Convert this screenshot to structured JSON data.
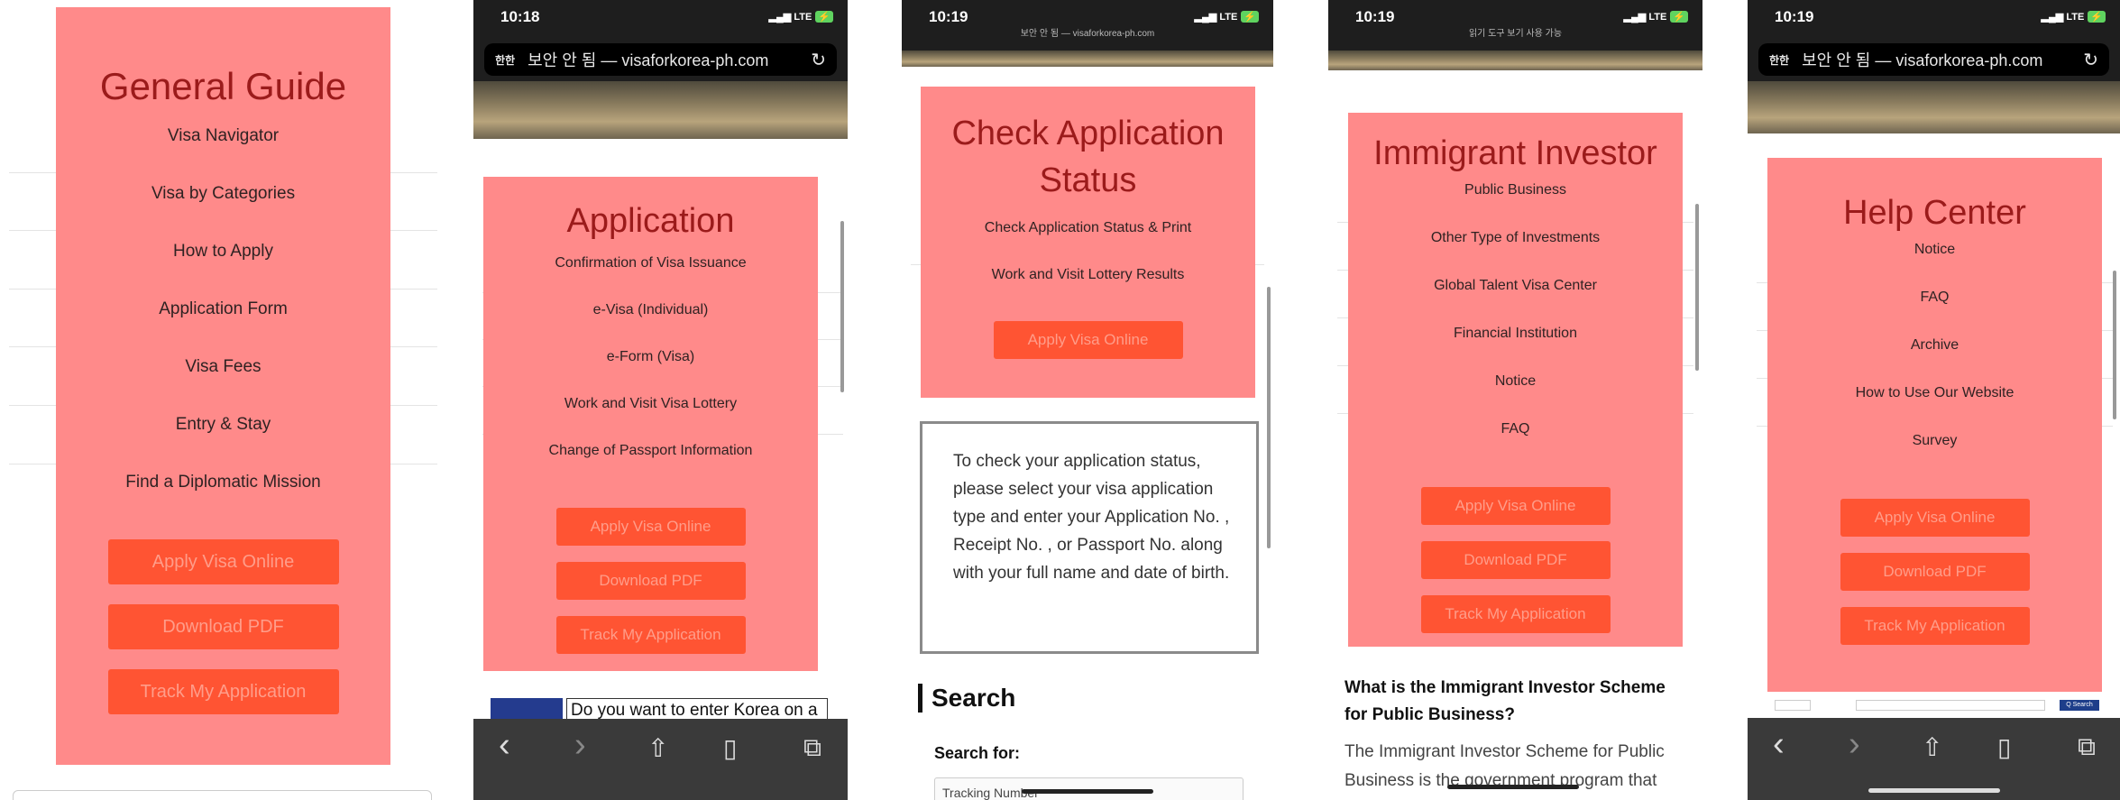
{
  "p1": {
    "title": "General Guide",
    "items": [
      "Visa Navigator",
      "Visa by Categories",
      "How to Apply",
      "Application Form",
      "Visa Fees",
      "Entry & Stay",
      "Find a Diplomatic Mission"
    ],
    "buttons": [
      "Apply Visa Online",
      "Download PDF",
      "Track My Application"
    ]
  },
  "p2": {
    "time": "10:18",
    "signal": "LTE",
    "lang": "한한",
    "url": "보안 안 됨 — visaforkorea-ph.com",
    "title": "Application",
    "items": [
      "Confirmation of Visa Issuance",
      "e-Visa (Individual)",
      "e-Form (Visa)",
      "Work and Visit Visa Lottery",
      "Change of Passport Information"
    ],
    "buttons": [
      "Apply Visa Online",
      "Download PDF",
      "Track My Application"
    ],
    "banner": "Do you want to enter Korea on a"
  },
  "p3": {
    "time": "10:19",
    "signal": "LTE",
    "mini_url": "보안 안 됨 — visaforkorea-ph.com",
    "title": "Check Application Status",
    "items": [
      "Check Application Status & Print",
      "Work and Visit Lottery Results"
    ],
    "buttons": [
      "Apply Visa Online"
    ],
    "info": "To check your application status, please select your visa application type and enter your Application No. , Receipt No. , or Passport No. along with your full name and date of birth.",
    "search_heading": "Search",
    "search_for_label": "Search for:",
    "search_for_value": "Tracking Number"
  },
  "p4": {
    "time": "10:19",
    "signal": "LTE",
    "mini_url": "읽기 도구 보기 사용 가능",
    "title": "Immigrant Investor",
    "items": [
      "Public Business",
      "Other Type of Investments",
      "Global Talent Visa Center",
      "Financial Institution",
      "Notice",
      "FAQ"
    ],
    "buttons": [
      "Apply Visa Online",
      "Download PDF",
      "Track My Application"
    ],
    "question": "What is the Immigrant Investor Scheme for Public Business?",
    "answer": "The Immigrant Investor Scheme for Public Business is the government program that"
  },
  "p5": {
    "time": "10:19",
    "signal": "LTE",
    "lang": "한한",
    "url": "보안 안 됨 — visaforkorea-ph.com",
    "title": "Help Center",
    "items": [
      "Notice",
      "FAQ",
      "Archive",
      "How to Use Our Website",
      "Survey"
    ],
    "buttons": [
      "Apply Visa Online",
      "Download PDF",
      "Track My Application"
    ],
    "search_btn": "Q Search"
  },
  "icons": {
    "back": "‹",
    "forward": "›",
    "share": "⇧",
    "bookmarks": "▯",
    "tabs": "⧉",
    "reload": "↻"
  },
  "colors": {
    "card": "#ff8a8a",
    "button": "#ff5433",
    "title": "#9b1b1b"
  }
}
